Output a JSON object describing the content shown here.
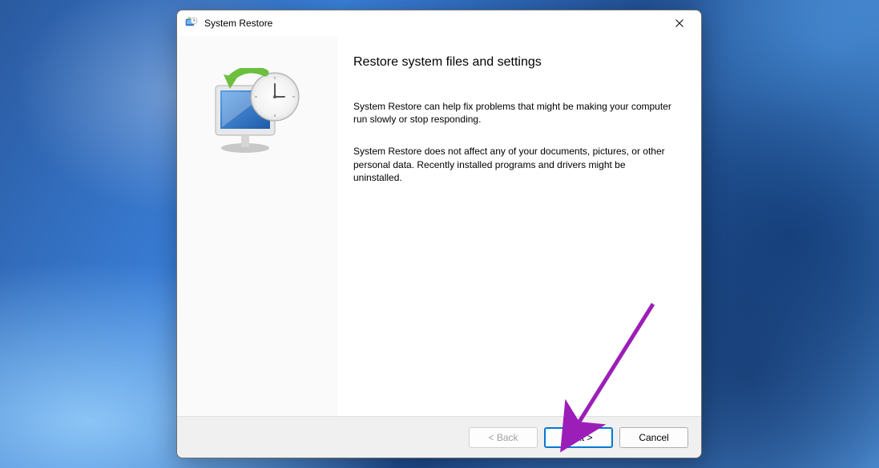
{
  "window": {
    "title": "System Restore"
  },
  "content": {
    "heading": "Restore system files and settings",
    "paragraph1": "System Restore can help fix problems that might be making your computer run slowly or stop responding.",
    "paragraph2": "System Restore does not affect any of your documents, pictures, or other personal data. Recently installed programs and drivers might be uninstalled."
  },
  "buttons": {
    "back": "< Back",
    "next": "Next >",
    "cancel": "Cancel"
  },
  "colors": {
    "arrow": "#9c1eb8"
  }
}
